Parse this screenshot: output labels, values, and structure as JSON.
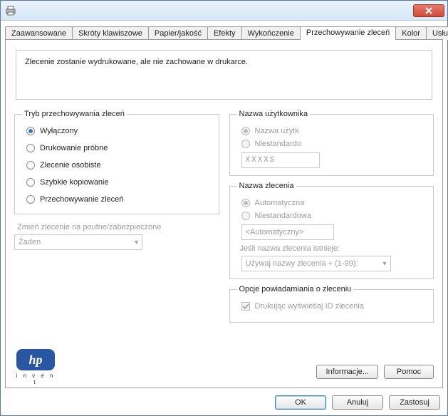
{
  "titlebar": {
    "title": ""
  },
  "tabs": {
    "items": [
      {
        "label": "Zaawansowane"
      },
      {
        "label": "Skróty klawiszowe"
      },
      {
        "label": "Papier/jakość"
      },
      {
        "label": "Efekty"
      },
      {
        "label": "Wykończenie"
      },
      {
        "label": "Przechowywanie zleceń"
      },
      {
        "label": "Kolor"
      },
      {
        "label": "Usługi"
      }
    ],
    "active_index": 5
  },
  "description": "Zlecenie zostanie wydrukowane, ale nie zachowane w drukarce.",
  "storage_mode": {
    "legend": "Tryb przechowywania zleceń",
    "options": [
      {
        "label": "Wyłączony",
        "checked": true
      },
      {
        "label": "Drukowanie próbne",
        "checked": false
      },
      {
        "label": "Zlecenie osobiste",
        "checked": false
      },
      {
        "label": "Szybkie kopiowanie",
        "checked": false
      },
      {
        "label": "Przechowywanie zleceń",
        "checked": false
      }
    ]
  },
  "make_private": {
    "label": "Zmień zlecenie na poufne/zabezpieczone",
    "select_value": "Żaden"
  },
  "user_name": {
    "legend": "Nazwa użytkownika",
    "options": [
      {
        "label": "Nazwa użytk",
        "checked": true
      },
      {
        "label": "Niestandardo",
        "checked": false
      }
    ],
    "input_value": "XXXXS"
  },
  "job_name": {
    "legend": "Nazwa zlecenia",
    "options": [
      {
        "label": "Automatyczna",
        "checked": true
      },
      {
        "label": "Niestandardowa",
        "checked": false
      }
    ],
    "input_value": "<Automatyczny>",
    "exists_label": "Jeśli nazwa zlecenia istnieje:",
    "exists_value": "Używaj nazwy zlecenia + (1-99):"
  },
  "notify": {
    "legend": "Opcje powiadamiania o zleceniu",
    "checkbox_label": "Drukując wyświetlaj ID zlecenia",
    "checked": true
  },
  "hp": {
    "invent": "i n v e n t",
    "logo_text": "hp"
  },
  "panel_buttons": {
    "info": "Informacje...",
    "help": "Pomoc"
  },
  "dialog_buttons": {
    "ok": "OK",
    "cancel": "Anuluj",
    "apply": "Zastosuj"
  }
}
